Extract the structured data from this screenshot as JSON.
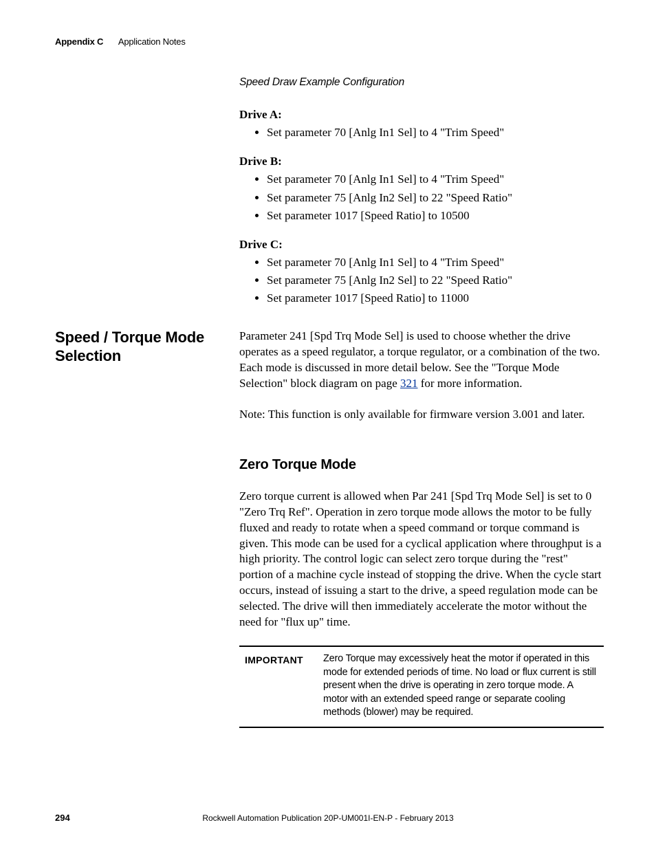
{
  "header": {
    "appendix": "Appendix C",
    "chapter": "Application Notes"
  },
  "speedDraw": {
    "title": "Speed Draw Example Configuration",
    "driveA": {
      "label": "Drive A:",
      "items": [
        "Set parameter 70 [Anlg In1 Sel] to 4 \"Trim Speed\""
      ]
    },
    "driveB": {
      "label": "Drive B:",
      "items": [
        "Set parameter 70 [Anlg In1 Sel] to 4 \"Trim Speed\"",
        "Set parameter 75 [Anlg In2 Sel] to 22 \"Speed Ratio\"",
        "Set parameter 1017 [Speed Ratio] to 10500"
      ]
    },
    "driveC": {
      "label": "Drive C:",
      "items": [
        "Set parameter 70 [Anlg In1 Sel] to 4 \"Trim Speed\"",
        "Set parameter 75 [Anlg In2 Sel] to 22 \"Speed Ratio\"",
        "Set parameter 1017 [Speed Ratio] to 11000"
      ]
    }
  },
  "speedTorque": {
    "heading": "Speed / Torque Mode Selection",
    "para1a": "Parameter 241 [Spd Trq Mode Sel] is used to choose whether the drive operates as a speed regulator, a torque regulator, or a combination of the two. Each mode is discussed in more detail below. See the \"Torque Mode Selection\" block diagram on page ",
    "pageRef": "321",
    "para1b": " for more information.",
    "note": "Note: This function is only available for firmware version 3.001 and later."
  },
  "zeroTorque": {
    "heading": "Zero Torque Mode",
    "para": "Zero torque current is allowed when Par 241 [Spd Trq Mode Sel] is set to 0 \"Zero Trq Ref\". Operation in zero torque mode allows the motor to be fully fluxed and ready to rotate when a speed command or torque command is given. This mode can be used for a cyclical application where throughput is a high priority. The control logic can select zero torque during the \"rest\" portion of a machine cycle instead of stopping the drive. When the cycle start occurs, instead of issuing a start to the drive, a speed regulation mode can be selected. The drive will then immediately accelerate the motor without the need for \"flux up\" time.",
    "important": {
      "label": "IMPORTANT",
      "body": "Zero Torque may excessively heat the motor if operated in this mode for extended periods of time. No load or flux current is still present when the drive is operating in zero torque mode. A motor with an extended speed range or separate cooling methods (blower) may be required."
    }
  },
  "footer": {
    "pageNumber": "294",
    "publication": "Rockwell Automation Publication 20P-UM001I-EN-P - February 2013"
  }
}
